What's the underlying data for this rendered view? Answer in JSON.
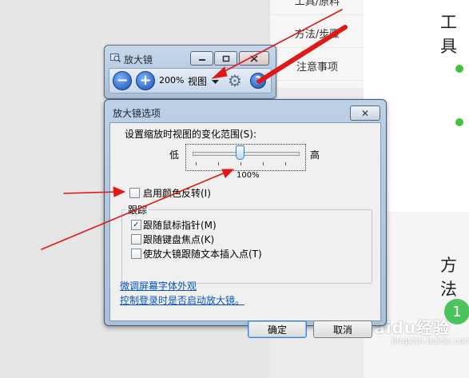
{
  "background_page": {
    "nav": [
      "工具/原料",
      "方法/步骤",
      "注意事项"
    ],
    "heading_tools": "工具",
    "heading_method": "方法",
    "step_number": "1",
    "watermark": "Baidu经验",
    "watermark_sub": "jingyan.baidu.com"
  },
  "magnifier": {
    "title": "放大镜",
    "zoom_out_symbol": "−",
    "zoom_in_symbol": "+",
    "zoom_level": "200%",
    "view_label": "视图",
    "help_symbol": "?"
  },
  "options_dialog": {
    "title": "放大镜选项",
    "close_symbol": "✕",
    "range_label": "设置缩放时视图的变化范围(S):",
    "slider_low": "低",
    "slider_high": "高",
    "slider_value": "100%",
    "slider_fraction": 0.45,
    "invert_colors": {
      "label": "启用颜色反转(I)",
      "checked": false
    },
    "tracking_group": "跟踪",
    "tracking_items": [
      {
        "label": "跟随鼠标指针(M)",
        "checked": true
      },
      {
        "label": "跟随键盘焦点(K)",
        "checked": false
      },
      {
        "label": "使放大镜跟随文本插入点(T)",
        "checked": false
      }
    ],
    "link_fonts": "微调屏幕字体外观",
    "link_logon": "控制登录时是否启动放大镜。",
    "ok_label": "确定",
    "cancel_label": "取消"
  },
  "colors": {
    "annotation_arrow": "#e01818",
    "bullet_green": "#44c040",
    "link": "#0a56b8"
  }
}
